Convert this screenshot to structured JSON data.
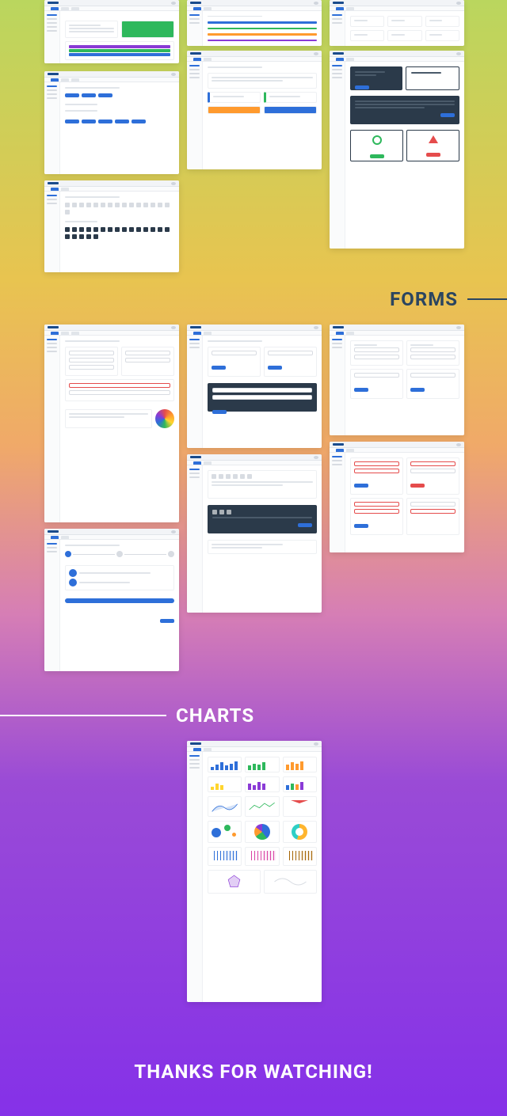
{
  "sections": {
    "forms": "FORMS",
    "charts": "CHARTS"
  },
  "footer": "THANKS FOR WATCHING!",
  "palette": {
    "primary": "#2e6fd9",
    "success": "#2eb85c",
    "warning": "#ff9a2e",
    "danger": "#e54c4c",
    "purple": "#8a3ad6",
    "dark": "#2b3a4a"
  },
  "screenshots": {
    "components_row1": [
      "buttons",
      "alerts",
      "cards",
      "modals"
    ],
    "components_row2": [
      "icons",
      "dialogs"
    ],
    "forms_row1": [
      "layout",
      "controls",
      "validation"
    ],
    "forms_row2": [
      "wizard",
      "editor",
      "states"
    ],
    "charts": [
      "bars",
      "lines",
      "pies",
      "funnels",
      "bubbles",
      "radar",
      "sparklines"
    ]
  },
  "chart_data": [
    {
      "type": "bar",
      "title": "Bar small",
      "categories": [
        "A",
        "B",
        "C",
        "D",
        "E",
        "F",
        "G",
        "H",
        "I",
        "J"
      ],
      "values": [
        30,
        50,
        70,
        40,
        60,
        80,
        45,
        65,
        55,
        75
      ]
    },
    {
      "type": "bar",
      "title": "Bar grouped",
      "categories": [
        "Q1",
        "Q2",
        "Q3",
        "Q4"
      ],
      "series": [
        {
          "name": "A",
          "values": [
            40,
            60,
            50,
            70
          ]
        },
        {
          "name": "B",
          "values": [
            30,
            50,
            45,
            60
          ]
        }
      ]
    },
    {
      "type": "bar",
      "title": "Bar stacked",
      "categories": [
        "A",
        "B",
        "C",
        "D",
        "E"
      ],
      "series": [
        {
          "name": "s1",
          "values": [
            20,
            30,
            25,
            35,
            28
          ]
        },
        {
          "name": "s2",
          "values": [
            25,
            20,
            30,
            25,
            32
          ]
        },
        {
          "name": "s3",
          "values": [
            15,
            20,
            18,
            22,
            20
          ]
        }
      ]
    },
    {
      "type": "line",
      "title": "Line trend",
      "x": [
        1,
        2,
        3,
        4,
        5,
        6,
        7,
        8,
        9,
        10
      ],
      "values": [
        20,
        35,
        30,
        45,
        40,
        55,
        50,
        60,
        58,
        65
      ]
    },
    {
      "type": "area",
      "title": "Area wave",
      "x": [
        1,
        2,
        3,
        4,
        5,
        6,
        7,
        8,
        9,
        10
      ],
      "values": [
        40,
        55,
        45,
        60,
        50,
        65,
        55,
        70,
        60,
        72
      ]
    },
    {
      "type": "pie",
      "title": "Pie share",
      "series": [
        {
          "name": "Blue",
          "values": [
            40
          ]
        },
        {
          "name": "Green",
          "values": [
            25
          ]
        },
        {
          "name": "Orange",
          "values": [
            20
          ]
        },
        {
          "name": "Purple",
          "values": [
            15
          ]
        }
      ]
    },
    {
      "type": "pie",
      "title": "Donut",
      "series": [
        {
          "name": "Yellow",
          "values": [
            55
          ]
        },
        {
          "name": "Teal",
          "values": [
            45
          ]
        }
      ]
    },
    {
      "type": "scatter",
      "title": "Bubble",
      "series": [
        {
          "name": "b1",
          "values": [
            [
              "20",
              30,
              18
            ]
          ]
        },
        {
          "name": "b2",
          "values": [
            [
              "45",
              55,
              10
            ]
          ]
        },
        {
          "name": "b3",
          "values": [
            [
              "70",
              40,
              6
            ]
          ]
        }
      ]
    }
  ]
}
